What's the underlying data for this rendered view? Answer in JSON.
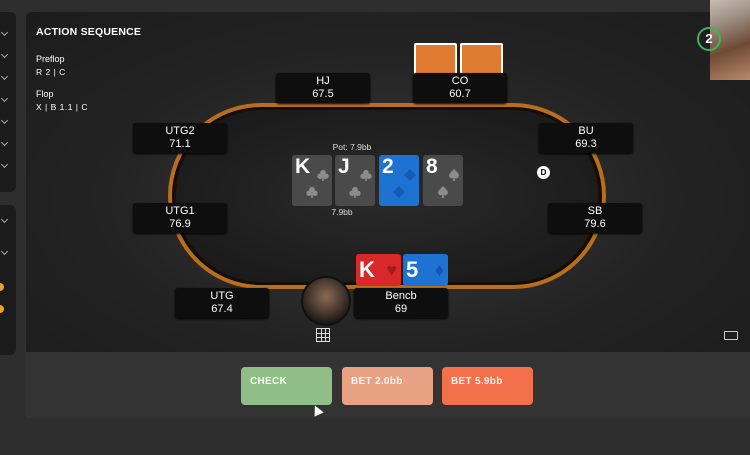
{
  "action_sequence": {
    "title": "ACTION SEQUENCE",
    "streets": [
      {
        "name": "Preflop",
        "actions": "R 2 | C"
      },
      {
        "name": "Flop",
        "actions": "X | B 1.1 | C"
      }
    ]
  },
  "seats": {
    "hj": {
      "position": "HJ",
      "stack": "67.5"
    },
    "co": {
      "position": "CO",
      "stack": "60.7"
    },
    "utg2": {
      "position": "UTG2",
      "stack": "71.1"
    },
    "bu": {
      "position": "BU",
      "stack": "69.3"
    },
    "utg1": {
      "position": "UTG1",
      "stack": "76.9"
    },
    "sb": {
      "position": "SB",
      "stack": "79.6"
    },
    "utg": {
      "position": "UTG",
      "stack": "67.4"
    },
    "hero": {
      "position": "Bencb",
      "stack": "69"
    }
  },
  "pot": {
    "label": "Pot: 7.9bb",
    "amount": "7.9bb"
  },
  "board": [
    {
      "rank": "K",
      "color": "grey",
      "suit": "club"
    },
    {
      "rank": "J",
      "color": "grey",
      "suit": "club"
    },
    {
      "rank": "2",
      "color": "blue",
      "suit": "diamond"
    },
    {
      "rank": "8",
      "color": "grey",
      "suit": "spade"
    }
  ],
  "hero_cards": [
    {
      "rank": "K",
      "suit_glyph": "♥",
      "color": "#d8282a"
    },
    {
      "rank": "5",
      "suit_glyph": "♦",
      "color": "#1e72d2"
    }
  ],
  "dealer_button": "D",
  "timer": "2",
  "buttons": {
    "check": "CHECK",
    "bet_small": "BET 2.0bb",
    "bet_large": "BET 5.9bb"
  },
  "colors": {
    "table_rim": "#b86e1c",
    "check": "#8fbf86",
    "bet_small": "#e9a184",
    "bet_large": "#f2704a",
    "blue_card": "#1e72d2",
    "red_card": "#d8282a",
    "card_back": "#e07c32"
  }
}
